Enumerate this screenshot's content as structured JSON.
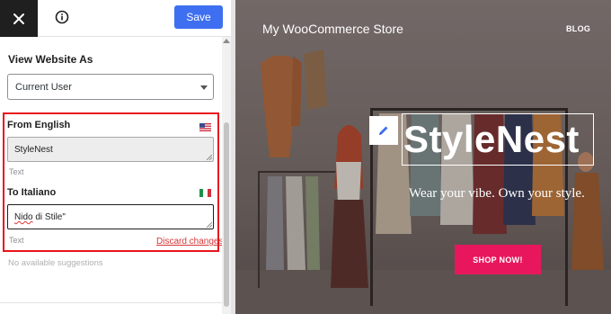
{
  "toolbar": {
    "close_icon": "close-icon",
    "info_icon": "info-icon",
    "save_label": "Save"
  },
  "view_website_as": {
    "title": "View Website As",
    "selected": "Current User"
  },
  "translation": {
    "from_label": "From English",
    "from_flag": "us-flag-icon",
    "source_value": "StyleNest",
    "source_type": "Text",
    "to_label": "To Italiano",
    "to_flag": "italy-flag-icon",
    "target_value_misspelled": "Nido",
    "target_value_rest": " di Stile\"",
    "target_type": "Text",
    "discard_label": "Discard changes",
    "highlight_color": "#e8141c"
  },
  "suggestions": {
    "empty_text": "No available suggestions"
  },
  "preview": {
    "site_title": "My WooCommerce Store",
    "nav": [
      "BLOG"
    ],
    "hero_title": "StyleNest",
    "tagline": "Wear your vibe. Own your style.",
    "cta_label": "SHOP NOW!",
    "edit_icon": "pencil-icon"
  },
  "colors": {
    "accent": "#3e6ff1",
    "cta": "#e8175d",
    "discard": "#d63638"
  }
}
